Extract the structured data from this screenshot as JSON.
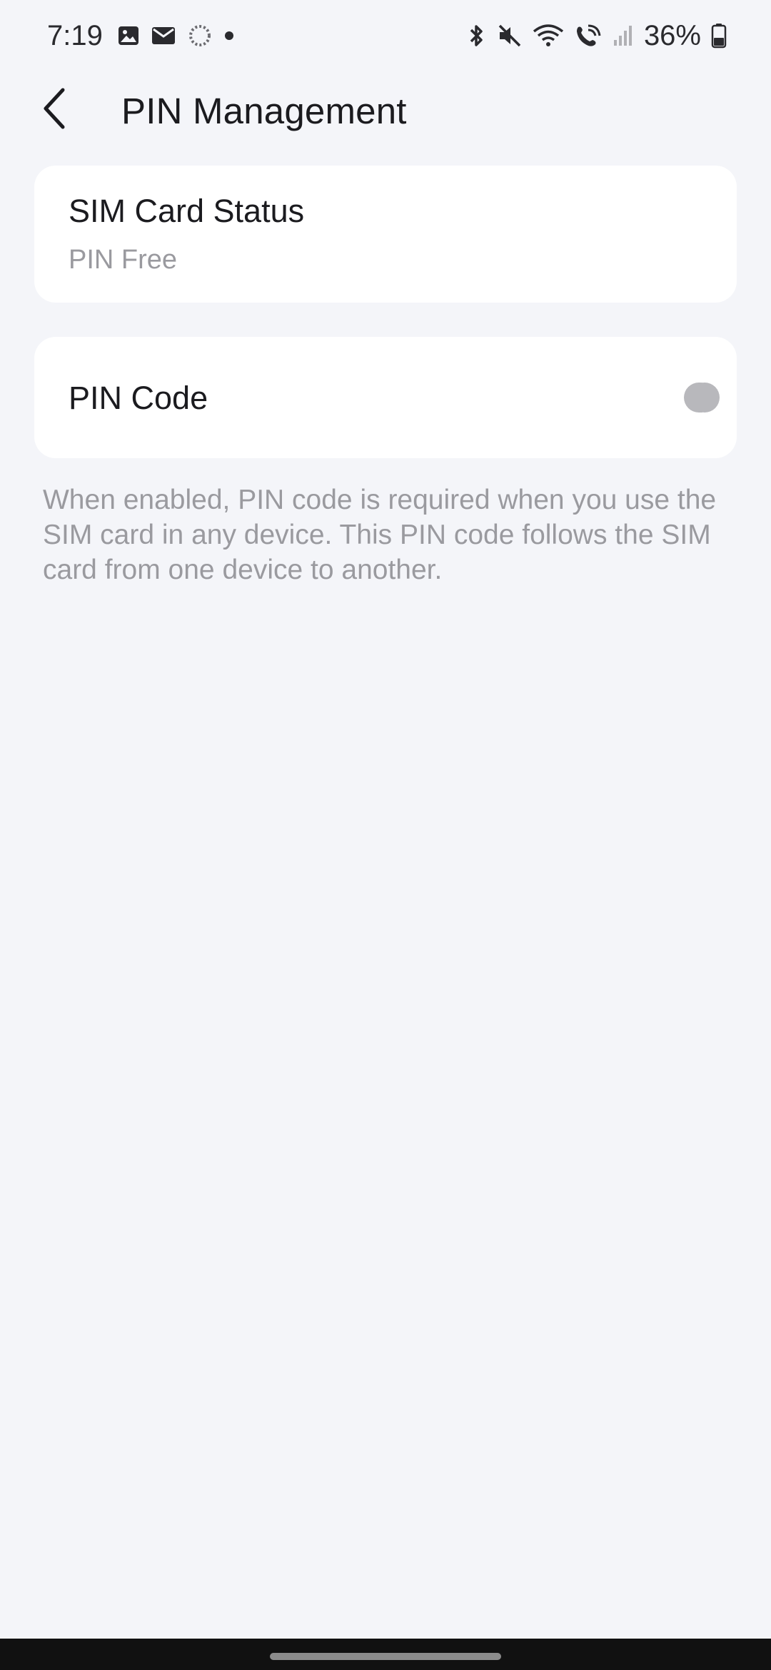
{
  "status_bar": {
    "time": "7:19",
    "left_icons": [
      "gallery-icon",
      "mail-icon",
      "sync-icon",
      "dot-icon"
    ],
    "right_icons": [
      "bluetooth-icon",
      "mute-icon",
      "wifi-icon",
      "wifi-call-icon",
      "signal-icon"
    ],
    "battery_percent": "36%"
  },
  "header": {
    "back_icon": "chevron-left-icon",
    "title": "PIN Management"
  },
  "sim_status": {
    "title": "SIM Card Status",
    "value": "PIN Free"
  },
  "pin_code": {
    "label": "PIN Code",
    "enabled": false
  },
  "description": "When enabled, PIN code is required when you use the SIM card in any device. This PIN code follows the SIM card from one device to another.",
  "colors": {
    "background": "#f4f5f9",
    "card": "#ffffff",
    "secondary_text": "#9a9a9f",
    "toggle_off": "#b8b8bc"
  }
}
